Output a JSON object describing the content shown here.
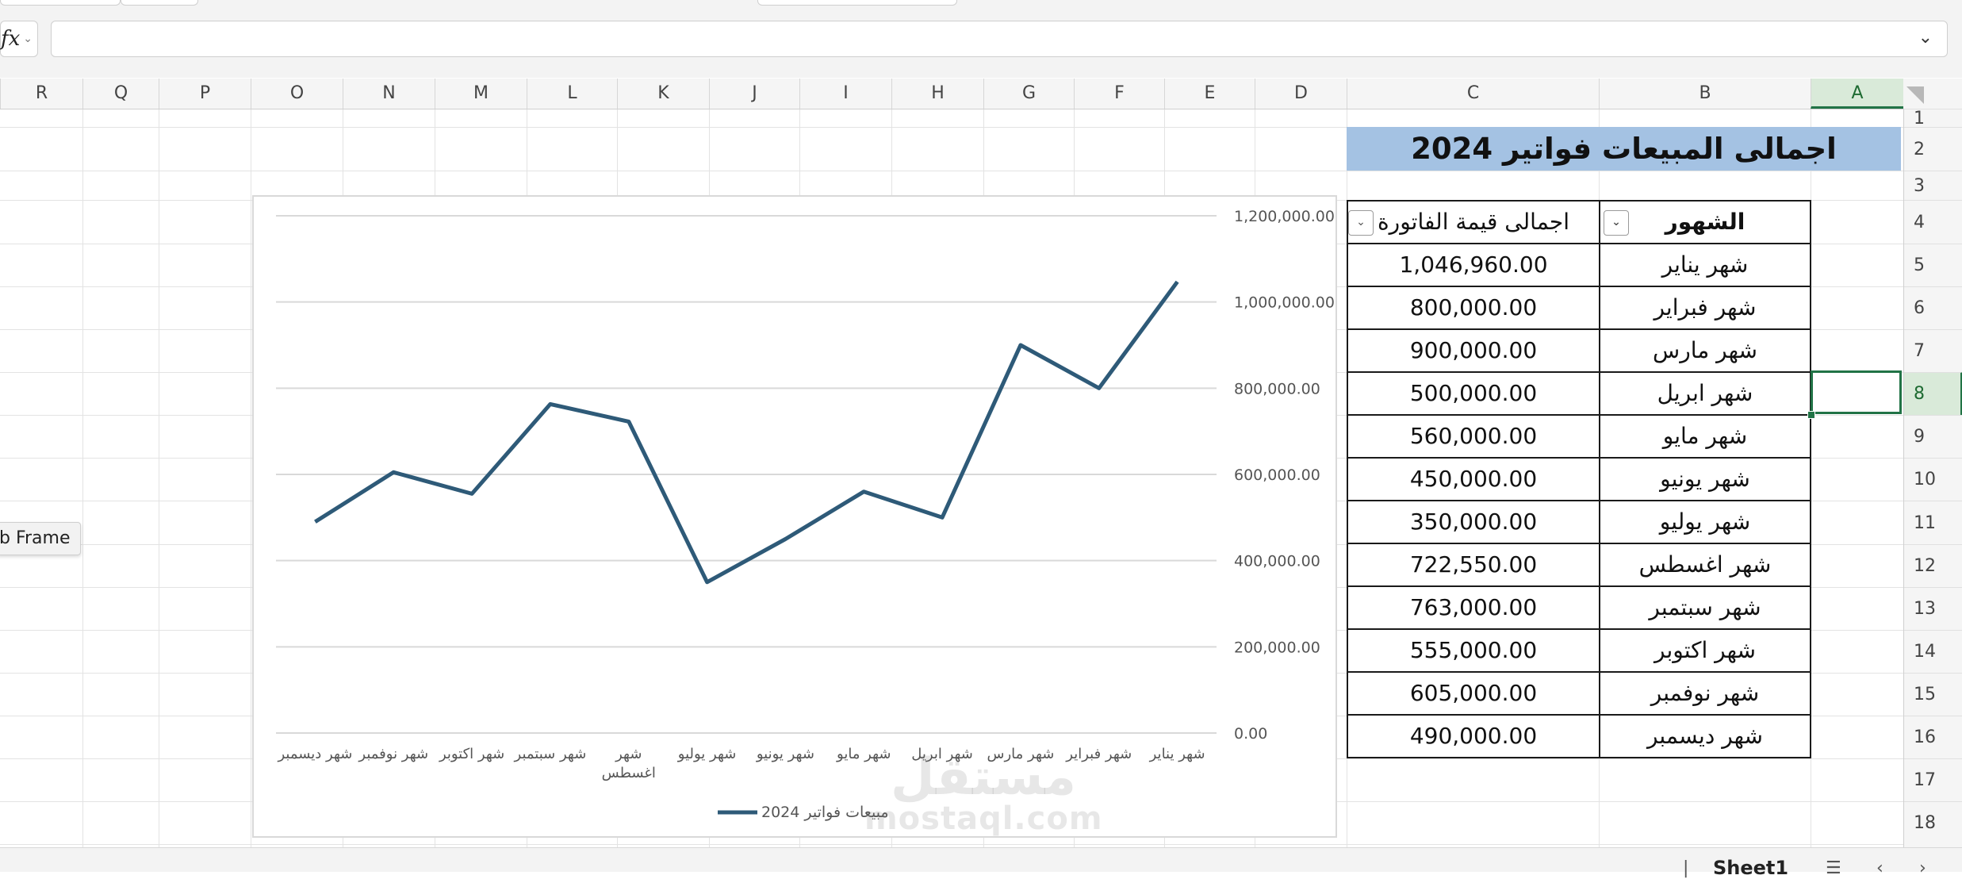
{
  "formula_bar": {
    "fx_label": "fx",
    "value": ""
  },
  "columns": [
    "R",
    "Q",
    "P",
    "O",
    "N",
    "M",
    "L",
    "K",
    "J",
    "I",
    "H",
    "G",
    "F",
    "E",
    "D",
    "C",
    "B",
    "A"
  ],
  "selected_column": "A",
  "rows": [
    "1",
    "2",
    "3",
    "4",
    "5",
    "6",
    "7",
    "8",
    "9",
    "10",
    "11",
    "12",
    "13",
    "14",
    "15",
    "16",
    "17",
    "18"
  ],
  "selected_row": "8",
  "sheet_title": "اجمالى المبيعات فواتير 2024",
  "table": {
    "headers": {
      "month": "الشهور",
      "total": "اجمالى قيمة الفاتورة"
    },
    "rows": [
      {
        "month": "شهر يناير",
        "total": "1,046,960.00"
      },
      {
        "month": "شهر فبراير",
        "total": "800,000.00"
      },
      {
        "month": "شهر مارس",
        "total": "900,000.00"
      },
      {
        "month": "شهر ابريل",
        "total": "500,000.00"
      },
      {
        "month": "شهر مايو",
        "total": "560,000.00"
      },
      {
        "month": "شهر يونيو",
        "total": "450,000.00"
      },
      {
        "month": "شهر يوليو",
        "total": "350,000.00"
      },
      {
        "month": "شهر اغسطس",
        "total": "722,550.00"
      },
      {
        "month": "شهر سبتمبر",
        "total": "763,000.00"
      },
      {
        "month": "شهر اكتوبر",
        "total": "555,000.00"
      },
      {
        "month": "شهر نوفمبر",
        "total": "605,000.00"
      },
      {
        "month": "شهر ديسمبر",
        "total": "490,000.00"
      }
    ]
  },
  "chart_data": {
    "type": "line",
    "categories": [
      "شهر يناير",
      "شهر فبراير",
      "شهر مارس",
      "شهر ابريل",
      "شهر مايو",
      "شهر يونيو",
      "شهر يوليو",
      "شهر اغسطس",
      "شهر سبتمبر",
      "شهر اكتوبر",
      "شهر نوفمبر",
      "شهر ديسمبر"
    ],
    "series": [
      {
        "name": "مبيعات فواتير 2024",
        "values": [
          1046960,
          800000,
          900000,
          500000,
          560000,
          450000,
          350000,
          722550,
          763000,
          555000,
          605000,
          490000
        ]
      }
    ],
    "yticks": [
      "0.00",
      "200,000.00",
      "400,000.00",
      "600,000.00",
      "800,000.00",
      "1,000,000.00",
      "1,200,000.00"
    ],
    "ylim": [
      0,
      1200000
    ],
    "x_direction": "right-to-left",
    "yaxis_side": "right",
    "grid": true,
    "legend": "bottom",
    "line_color": "#2e5a78"
  },
  "tooltip_text": "b Frame",
  "sheet_tab": "Sheet1",
  "watermark": {
    "arabic": "مستقل",
    "latin": "mostaql.com"
  }
}
